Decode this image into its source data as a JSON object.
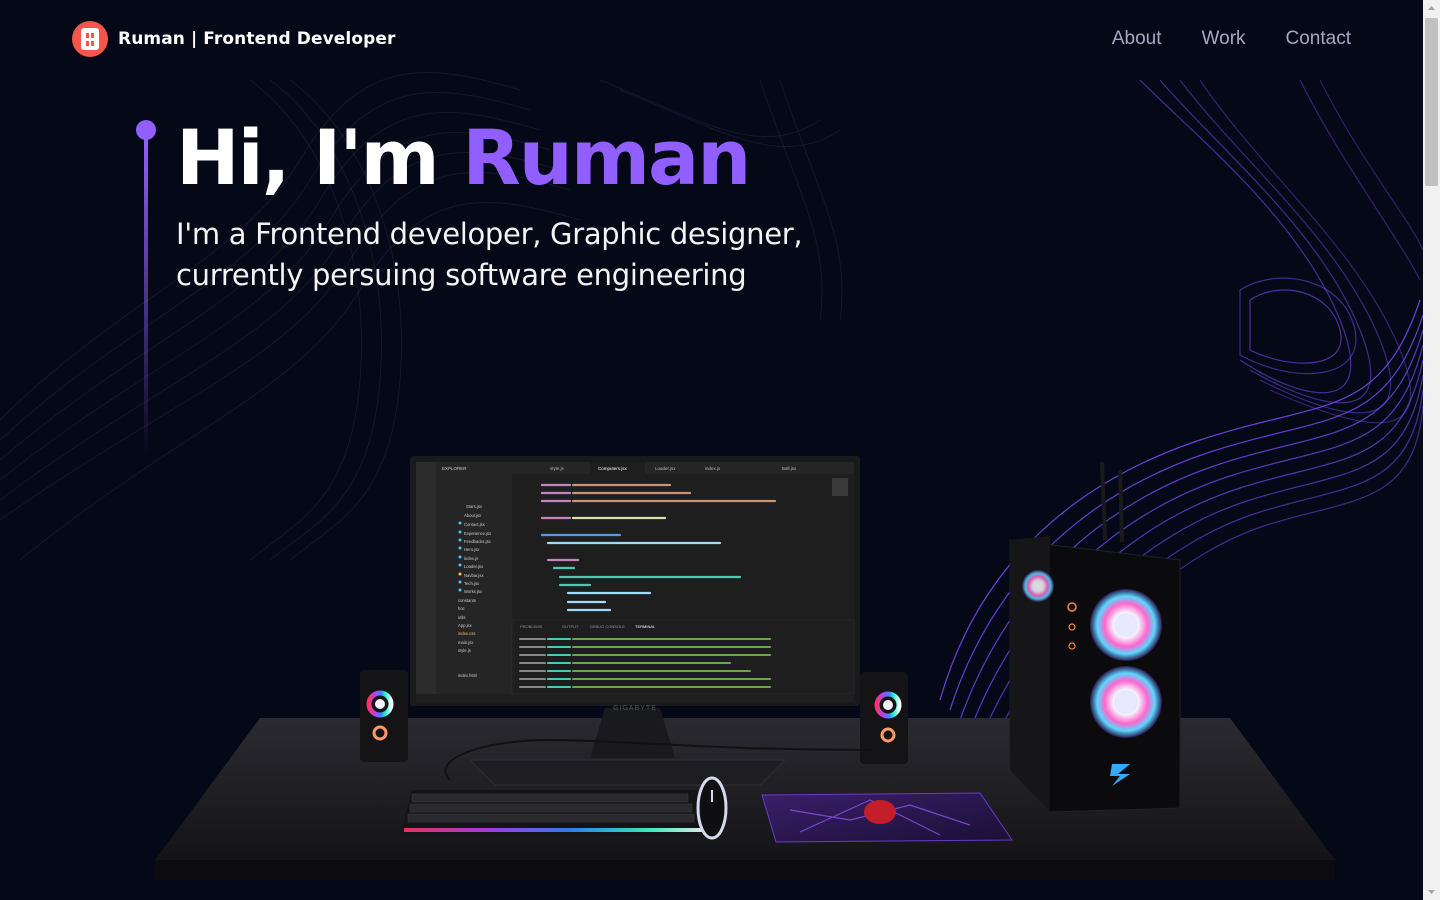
{
  "navbar": {
    "brand_name": "Ruman",
    "brand_separator": "|",
    "brand_role": "Frontend Developer",
    "links": [
      {
        "label": "About"
      },
      {
        "label": "Work"
      },
      {
        "label": "Contact"
      }
    ]
  },
  "hero": {
    "greeting": "Hi, I'm ",
    "name": "Ruman",
    "subtitle_line1": "I'm a Frontend developer, Graphic designer,",
    "subtitle_line2": "currently persuing software engineering"
  },
  "scene": {
    "monitor_brand": "GIGABYTE",
    "editor": {
      "explorer_label": "EXPLORER",
      "tabs": [
        "style.js",
        "Computers.jsx",
        "Loader.jsx",
        "index.js",
        "Ball.jsx"
      ],
      "files": [
        "Stars.jsx",
        "About.jsx",
        "Contact.jsx",
        "Experience.jsx",
        "Feedbacks.jsx",
        "Hero.jsx",
        "index.js",
        "Loader.jsx",
        "Navbar.jsx",
        "Tech.jsx",
        "Works.jsx",
        "constants",
        "hoc",
        "utils",
        "App.jsx",
        "index.css",
        "main.jsx",
        "style.js",
        "index.html"
      ],
      "panel_tabs": [
        "PROBLEMS",
        "OUTPUT",
        "DEBUG CONSOLE",
        "TERMINAL"
      ]
    }
  },
  "colors": {
    "background": "#050816",
    "accent": "#915eff",
    "nav_text": "#aaa6c3",
    "logo": "#f4564b"
  }
}
